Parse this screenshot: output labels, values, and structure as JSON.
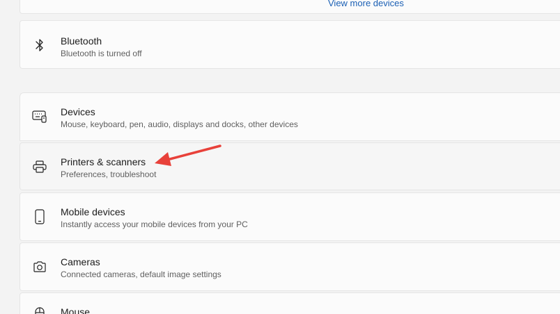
{
  "top": {
    "view_more_label": "View more devices"
  },
  "bluetooth": {
    "title": "Bluetooth",
    "subtitle": "Bluetooth is turned off",
    "icon": "bluetooth-icon"
  },
  "items": [
    {
      "title": "Devices",
      "subtitle": "Mouse, keyboard, pen, audio, displays and docks, other devices",
      "icon": "devices-icon"
    },
    {
      "title": "Printers & scanners",
      "subtitle": "Preferences, troubleshoot",
      "icon": "printer-icon"
    },
    {
      "title": "Mobile devices",
      "subtitle": "Instantly access your mobile devices from your PC",
      "icon": "mobile-phone-icon"
    },
    {
      "title": "Cameras",
      "subtitle": "Connected cameras, default image settings",
      "icon": "camera-icon"
    },
    {
      "title": "Mouse",
      "subtitle": "",
      "icon": "mouse-icon"
    }
  ],
  "annotation": {
    "arrow_color": "#e8413a"
  }
}
